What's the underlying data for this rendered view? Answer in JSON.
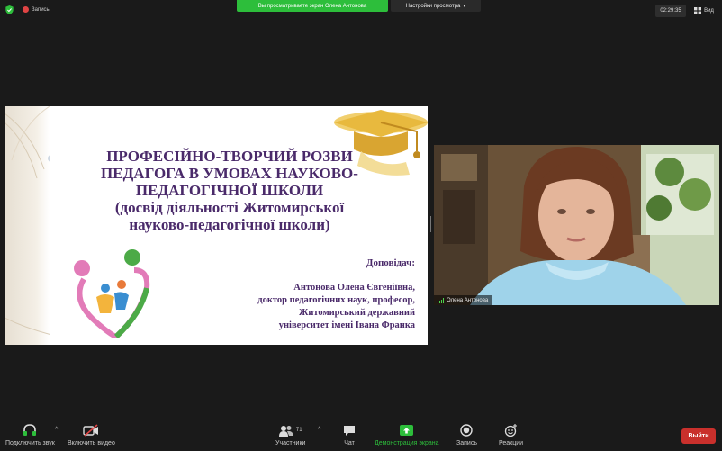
{
  "top_bar": {
    "recording_label": "Запись",
    "share_banner": "Вы просматриваете экран Олена Антонова",
    "view_options_label": "Настройки просмотра",
    "clock": "02:29:35",
    "view_label": "Вид"
  },
  "slide": {
    "title_lines": [
      "ПРОФЕСІЙНО-ТВОРЧИЙ РОЗВИ",
      "ПЕДАГОГА В УМОВАХ НАУКОВО-",
      "ПЕДАГОГІЧНОЇ ШКОЛИ",
      "(досвід діяльності Житомирської",
      "науково-педагогічної школи)"
    ],
    "reporter_label": "Доповідач:",
    "reporter_lines": [
      "Антонова Олена Євгеніївна,",
      "доктор педагогічних наук, професор,",
      "Житомирський державний",
      "університет імені Івана Франка"
    ]
  },
  "video": {
    "participant_name": "Олена Антонова"
  },
  "toolbar": {
    "mute_label": "Подключить звук",
    "video_label": "Включить видео",
    "participants_label": "Участники",
    "participants_count": "71",
    "chat_label": "Чат",
    "share_label": "Демонстрация экрана",
    "record_label": "Запись",
    "reactions_label": "Реакции",
    "exit_label": "Выйти"
  },
  "colors": {
    "share_green": "#2dbe3b",
    "exit_red": "#c9302c",
    "slide_text_purple": "#4a2a6a"
  }
}
